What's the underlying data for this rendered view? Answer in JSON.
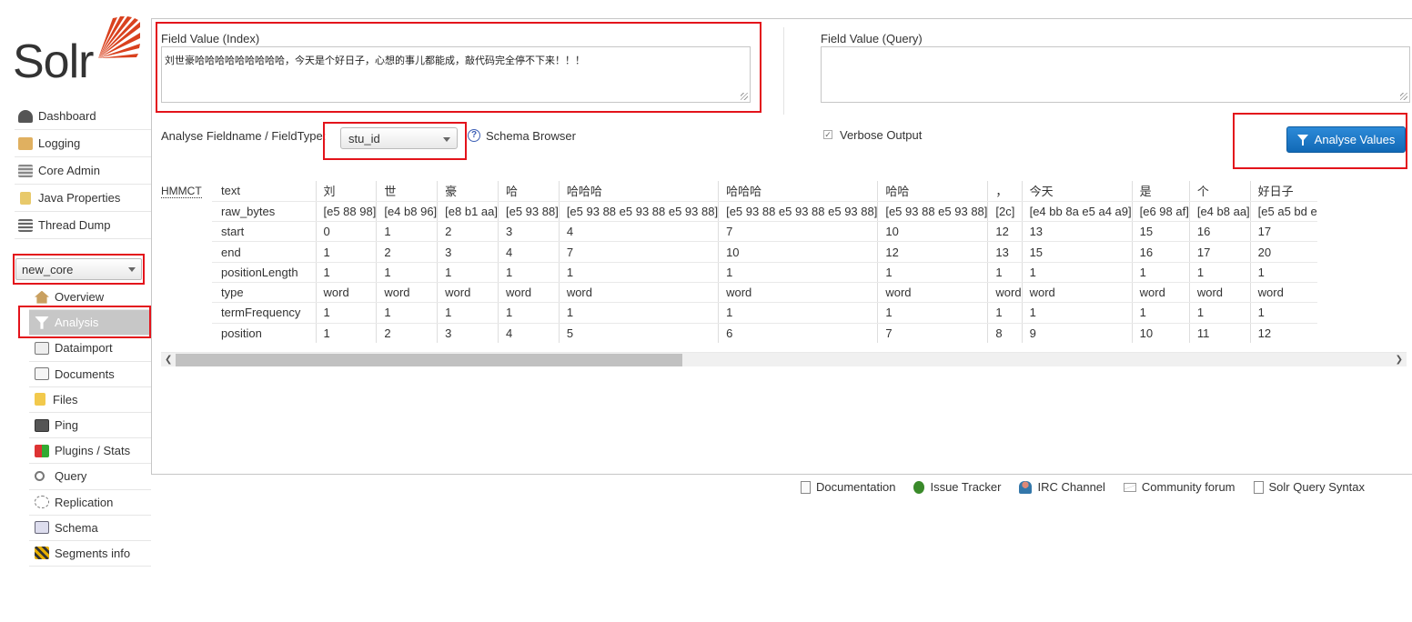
{
  "logo": {
    "text": "Solr"
  },
  "nav": [
    {
      "label": "Dashboard",
      "icon": "dashboard-icon"
    },
    {
      "label": "Logging",
      "icon": "logging-icon"
    },
    {
      "label": "Core Admin",
      "icon": "core-admin-icon"
    },
    {
      "label": "Java Properties",
      "icon": "java-icon"
    },
    {
      "label": "Thread Dump",
      "icon": "thread-dump-icon"
    }
  ],
  "core_selector": {
    "value": "new_core"
  },
  "core_nav": [
    {
      "label": "Overview",
      "icon": "house-icon"
    },
    {
      "label": "Analysis",
      "icon": "funnel-icon",
      "active": true
    },
    {
      "label": "Dataimport",
      "icon": "dataimport-icon"
    },
    {
      "label": "Documents",
      "icon": "documents-icon"
    },
    {
      "label": "Files",
      "icon": "folder-icon"
    },
    {
      "label": "Ping",
      "icon": "ping-icon"
    },
    {
      "label": "Plugins / Stats",
      "icon": "plugins-icon"
    },
    {
      "label": "Query",
      "icon": "magnifier-icon"
    },
    {
      "label": "Replication",
      "icon": "replication-icon"
    },
    {
      "label": "Schema",
      "icon": "schema-icon"
    },
    {
      "label": "Segments info",
      "icon": "segments-icon"
    }
  ],
  "analysis": {
    "index_label": "Field Value (Index)",
    "index_value": "刘世豪哈哈哈哈哈哈哈哈哈，今天是个好日子，心想的事儿都能成，敲代码完全停不下来！！！",
    "query_label": "Field Value (Query)",
    "query_value": "",
    "fieldtype_label": "Analyse Fieldname / FieldType:",
    "fieldtype_value": "stu_id",
    "schema_browser": "Schema Browser",
    "verbose_label": "Verbose Output",
    "verbose_checked": true,
    "analyse_button": "Analyse Values",
    "tokenizer_abbr": "HMMCT"
  },
  "token_table": {
    "row_headers": [
      "text",
      "raw_bytes",
      "start",
      "end",
      "positionLength",
      "type",
      "termFrequency",
      "position"
    ],
    "tokens": [
      {
        "text": "刘",
        "raw_bytes": "[e5 88 98]",
        "start": "0",
        "end": "1",
        "positionLength": "1",
        "type": "word",
        "termFrequency": "1",
        "position": "1"
      },
      {
        "text": "世",
        "raw_bytes": "[e4 b8 96]",
        "start": "1",
        "end": "2",
        "positionLength": "1",
        "type": "word",
        "termFrequency": "1",
        "position": "2"
      },
      {
        "text": "豪",
        "raw_bytes": "[e8 b1 aa]",
        "start": "2",
        "end": "3",
        "positionLength": "1",
        "type": "word",
        "termFrequency": "1",
        "position": "3"
      },
      {
        "text": "哈",
        "raw_bytes": "[e5 93 88]",
        "start": "3",
        "end": "4",
        "positionLength": "1",
        "type": "word",
        "termFrequency": "1",
        "position": "4"
      },
      {
        "text": "哈哈哈",
        "raw_bytes": "[e5 93 88 e5 93 88 e5 93 88]",
        "start": "4",
        "end": "7",
        "positionLength": "1",
        "type": "word",
        "termFrequency": "1",
        "position": "5"
      },
      {
        "text": "哈哈哈",
        "raw_bytes": "[e5 93 88 e5 93 88 e5 93 88]",
        "start": "7",
        "end": "10",
        "positionLength": "1",
        "type": "word",
        "termFrequency": "1",
        "position": "6"
      },
      {
        "text": "哈哈",
        "raw_bytes": "[e5 93 88 e5 93 88]",
        "start": "10",
        "end": "12",
        "positionLength": "1",
        "type": "word",
        "termFrequency": "1",
        "position": "7"
      },
      {
        "text": "，",
        "raw_bytes": "[2c]",
        "start": "12",
        "end": "13",
        "positionLength": "1",
        "type": "word",
        "termFrequency": "1",
        "position": "8"
      },
      {
        "text": "今天",
        "raw_bytes": "[e4 bb 8a e5 a4 a9]",
        "start": "13",
        "end": "15",
        "positionLength": "1",
        "type": "word",
        "termFrequency": "1",
        "position": "9"
      },
      {
        "text": "是",
        "raw_bytes": "[e6 98 af]",
        "start": "15",
        "end": "16",
        "positionLength": "1",
        "type": "word",
        "termFrequency": "1",
        "position": "10"
      },
      {
        "text": "个",
        "raw_bytes": "[e4 b8 aa]",
        "start": "16",
        "end": "17",
        "positionLength": "1",
        "type": "word",
        "termFrequency": "1",
        "position": "11"
      },
      {
        "text": "好日子",
        "raw_bytes": "[e5 a5 bd e",
        "start": "17",
        "end": "20",
        "positionLength": "1",
        "type": "word",
        "termFrequency": "1",
        "position": "12"
      }
    ]
  },
  "footer": [
    {
      "label": "Documentation",
      "icon": "document-icon"
    },
    {
      "label": "Issue Tracker",
      "icon": "bug-icon"
    },
    {
      "label": "IRC Channel",
      "icon": "irc-icon"
    },
    {
      "label": "Community forum",
      "icon": "mail-icon"
    },
    {
      "label": "Solr Query Syntax",
      "icon": "syntax-icon"
    }
  ],
  "colors": {
    "accent": "#1a76c8",
    "highlight_box": "#e3131b",
    "solr_orange": "#d9411e"
  }
}
